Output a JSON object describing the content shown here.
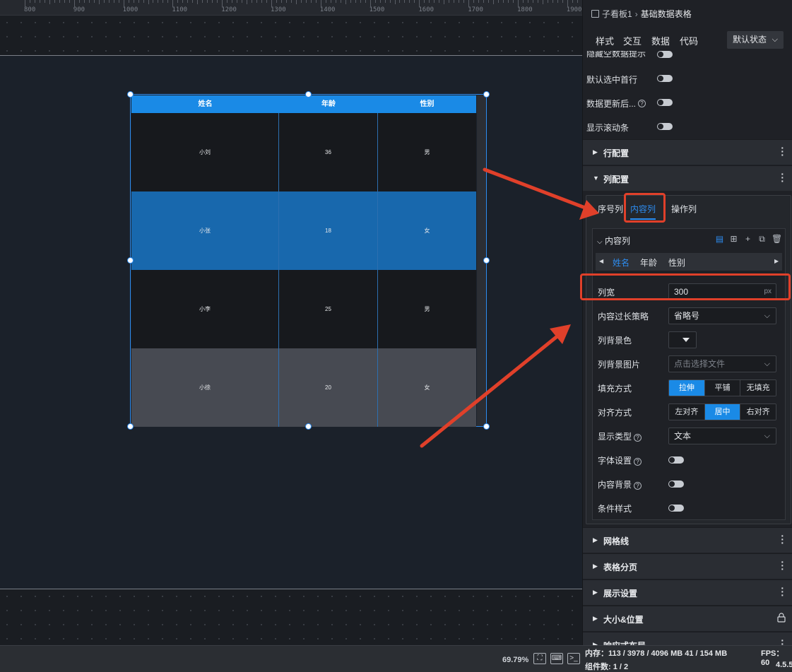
{
  "ruler": {
    "labels": [
      "800",
      "900",
      "1000",
      "1100",
      "1200",
      "1300",
      "1400",
      "1500",
      "1600",
      "1700",
      "1800",
      "1900"
    ]
  },
  "table": {
    "headers": [
      "姓名",
      "年龄",
      "性别"
    ],
    "rows": [
      [
        "小刘",
        "36",
        "男"
      ],
      [
        "小张",
        "18",
        "女"
      ],
      [
        "小李",
        "25",
        "男"
      ],
      [
        "小徐",
        "20",
        "女"
      ]
    ]
  },
  "status": {
    "zoom": "69.79%",
    "memory": "内存：113 / 3978 / 4096 MB  41 / 154 MB",
    "fps": "FPS：60",
    "components": "组件数: 1 / 2",
    "version": "4.5.5"
  },
  "panel": {
    "breadcrumb": {
      "parent": "子看板1",
      "sep": "›",
      "current": "基础数据表格"
    },
    "tabs": [
      "样式",
      "交互",
      "数据",
      "代码"
    ],
    "state_select": "默认状态",
    "toggles_top": [
      {
        "label": "隐藏空数据提示"
      },
      {
        "label": "默认选中首行"
      },
      {
        "label": "数据更新后..."
      },
      {
        "label": "显示滚动条"
      }
    ],
    "sections": {
      "row_config": "行配置",
      "col_config": "列配置",
      "grid": "网格线",
      "pagination": "表格分页",
      "display": "展示设置",
      "size_pos": "大小&位置",
      "responsive": "响应式布局"
    },
    "col_tabs": [
      "序号列",
      "内容列",
      "操作列"
    ],
    "inner": {
      "title": "内容列",
      "columns": [
        "姓名",
        "年龄",
        "性别"
      ],
      "width_label": "列宽",
      "width_value": "300",
      "width_unit": "px",
      "overflow_label": "内容过长策略",
      "overflow_value": "省略号",
      "bgcolor_label": "列背景色",
      "bgimage_label": "列背景图片",
      "bgimage_placeholder": "点击选择文件",
      "fill_label": "填充方式",
      "fill_options": [
        "拉伸",
        "平铺",
        "无填充"
      ],
      "align_label": "对齐方式",
      "align_options": [
        "左对齐",
        "居中",
        "右对齐"
      ],
      "display_label": "显示类型",
      "display_value": "文本",
      "font_label": "字体设置",
      "content_bg_label": "内容背景",
      "cond_label": "条件样式"
    }
  },
  "colors": {
    "accent": "#1a8ae6",
    "annotation": "#e0402a"
  }
}
